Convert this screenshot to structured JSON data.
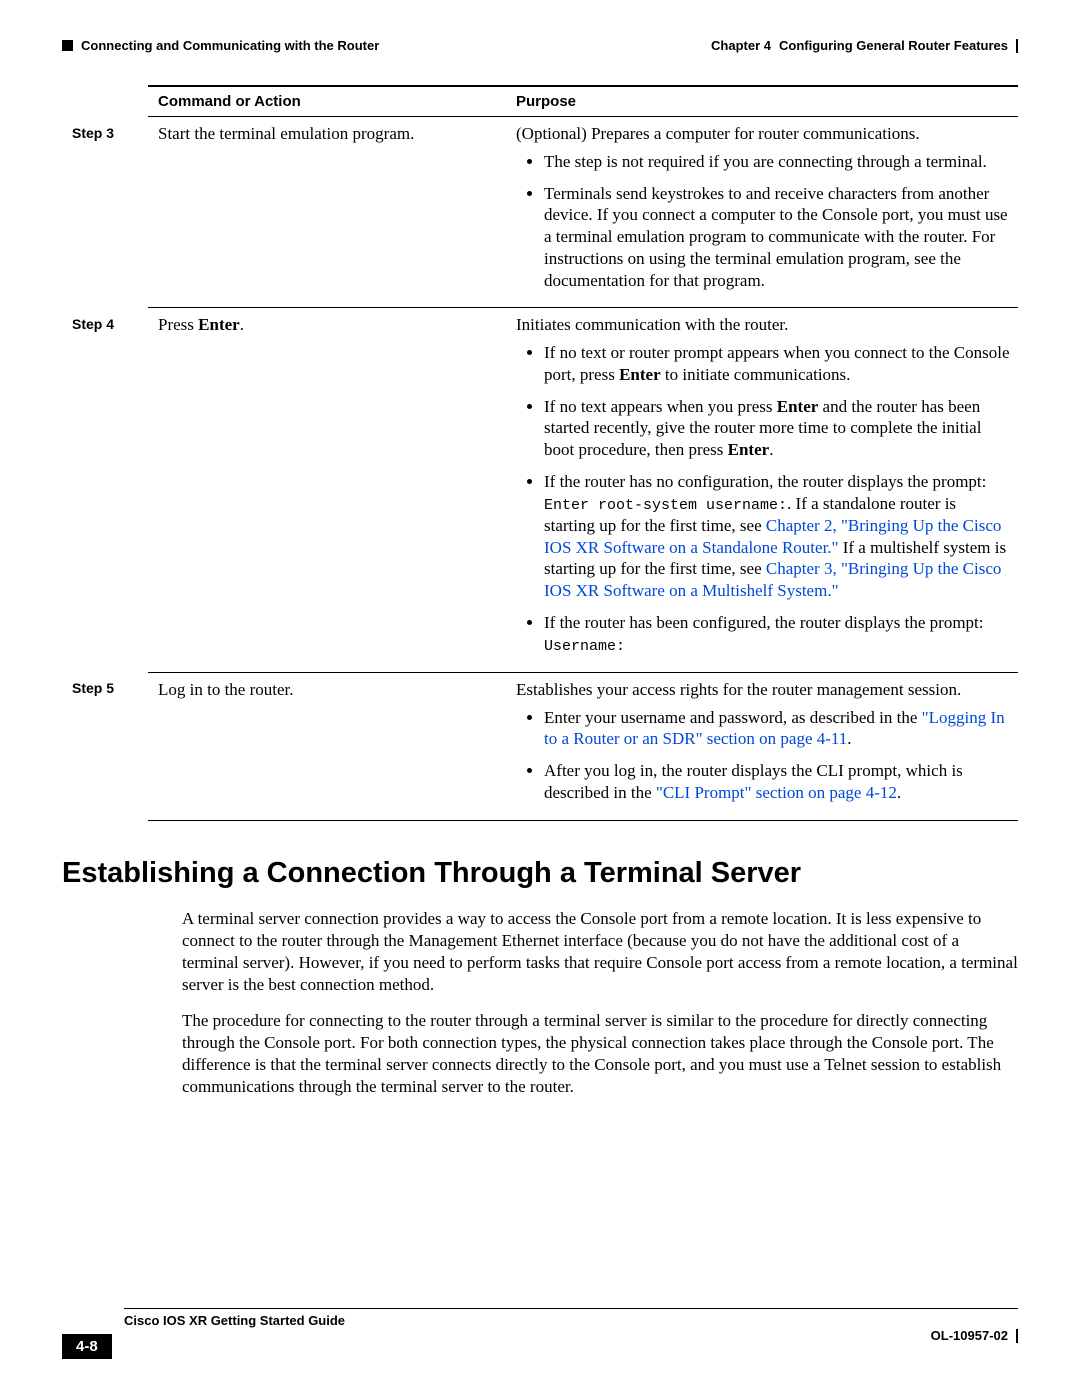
{
  "header": {
    "section": "Connecting and Communicating with the Router",
    "chapter_label": "Chapter 4",
    "chapter_title": "Configuring General Router Features"
  },
  "table": {
    "col1": "Command or Action",
    "col2": "Purpose",
    "step3label": "Step 3",
    "step4label": "Step 4",
    "step5label": "Step 5",
    "s3cmd": "Start the terminal emulation program.",
    "s3p_intro": "(Optional) Prepares a computer for router communications.",
    "s3b1": "The step is not required if you are connecting through a terminal.",
    "s3b2": "Terminals send keystrokes to and receive characters from another device. If you connect a computer to the Console port, you must use a terminal emulation program to communicate with the router. For instructions on using the terminal emulation program, see the documentation for that program.",
    "s4cmd_a": "Press ",
    "s4cmd_b": "Enter",
    "s4cmd_c": ".",
    "s4p_intro": "Initiates communication with the router.",
    "s4b1a": "If no text or router prompt appears when you connect to the Console port, press ",
    "s4b1b": "Enter",
    "s4b1c": " to initiate communications.",
    "s4b2a": "If no text appears when you press ",
    "s4b2b": "Enter",
    "s4b2c": " and the router has been started recently, give the router more time to complete the initial boot procedure, then press ",
    "s4b2d": "Enter",
    "s4b2e": ".",
    "s4b3a": "If the router has no configuration, the router displays the prompt: ",
    "s4b3code": "Enter root-system username:",
    "s4b3b": ". If a standalone router is starting up for the first time, see ",
    "s4b3link1": "Chapter 2, \"Bringing Up the Cisco IOS XR Software on a Standalone Router.\"",
    "s4b3c": " If a multishelf system is starting up for the first time, see ",
    "s4b3link2": "Chapter 3, \"Bringing Up the Cisco IOS XR Software on a Multishelf System.\"",
    "s4b4a": "If the router has been configured, the router displays the prompt: ",
    "s4b4code": "Username:",
    "s5cmd": "Log in to the router.",
    "s5p_intro": "Establishes your access rights for the router management session.",
    "s5b1a": "Enter your username and password, as described in the ",
    "s5b1link": "\"Logging In to a Router or an SDR\" section on page 4-11",
    "s5b1b": ".",
    "s5b2a": "After you log in, the router displays the CLI prompt, which is described in the ",
    "s5b2link": "\"CLI Prompt\" section on page 4-12",
    "s5b2b": "."
  },
  "section_title": "Establishing a Connection Through a Terminal Server",
  "para1": "A terminal server connection provides a way to access the Console port from a remote location. It is less expensive to connect to the router through the Management Ethernet interface (because you do not have the additional cost of a terminal server). However, if you need to perform tasks that require Console port access from a remote location, a terminal server is the best connection method.",
  "para2": "The procedure for connecting to the router through a terminal server is similar to the procedure for directly connecting through the Console port. For both connection types, the physical connection takes place through the Console port. The difference is that the terminal server connects directly to the Console port, and you must use a Telnet session to establish communications through the terminal server to the router.",
  "footer": {
    "guide": "Cisco IOS XR Getting Started Guide",
    "pagenum": "4-8",
    "docnum": "OL-10957-02"
  }
}
